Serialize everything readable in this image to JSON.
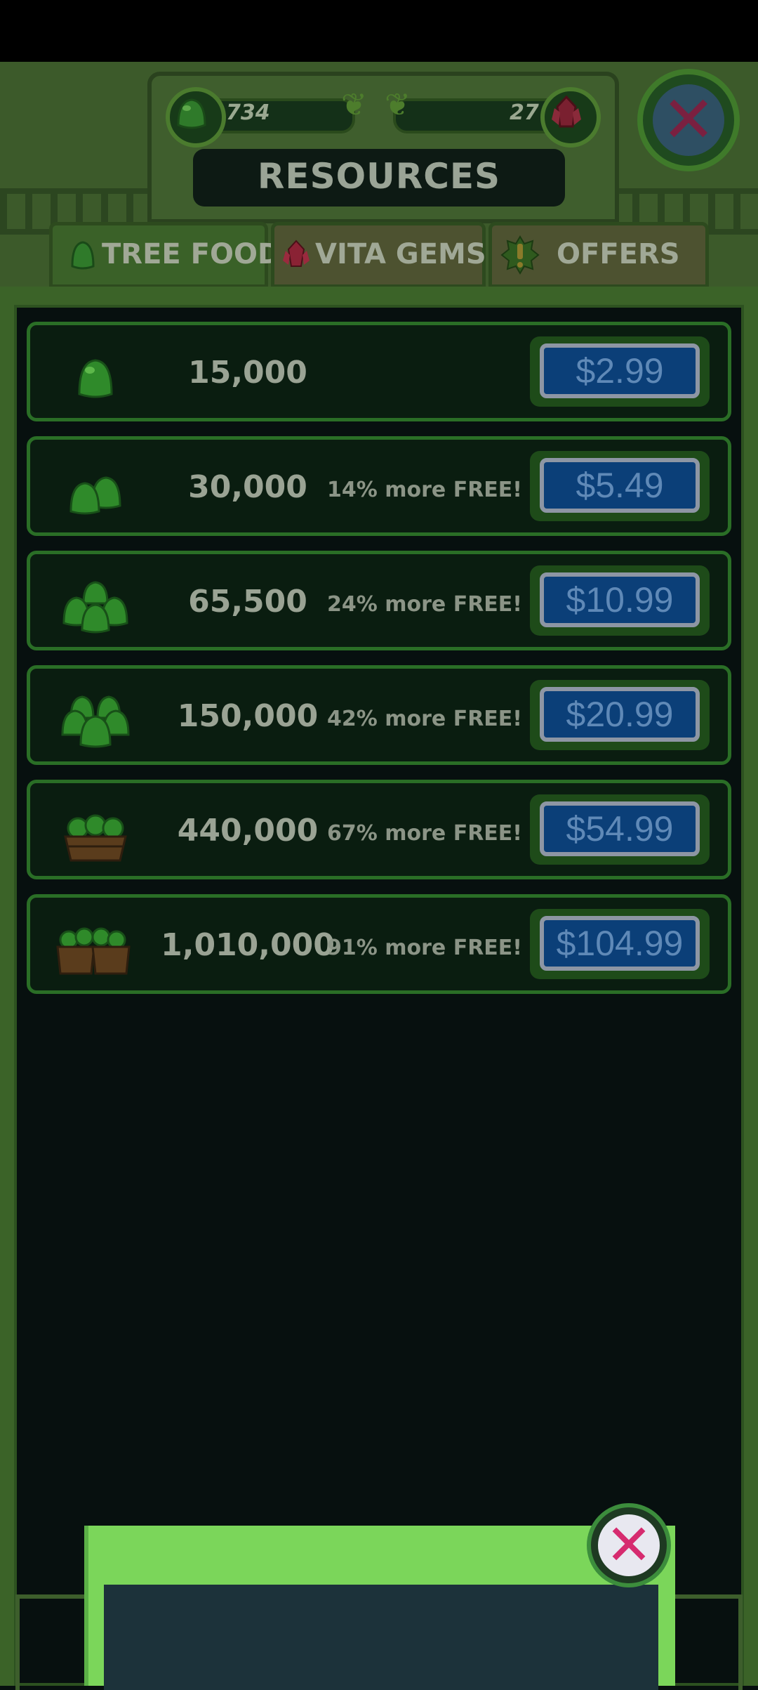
{
  "header": {
    "tree_food_count": "734",
    "vita_gems_count": "27",
    "title": "RESOURCES"
  },
  "tabs": [
    {
      "label": "TREE FOOD",
      "icon": "tree-food-icon",
      "active": true
    },
    {
      "label": "VITA GEMS",
      "icon": "gem-icon",
      "active": false
    },
    {
      "label": "OFFERS",
      "icon": "exclamation-badge-icon",
      "active": false
    }
  ],
  "offers": [
    {
      "quantity": "15,000",
      "bonus": "",
      "price": "$2.99",
      "icon": "single-gumdrop-icon"
    },
    {
      "quantity": "30,000",
      "bonus": "14% more FREE!",
      "price": "$5.49",
      "icon": "two-gumdrops-icon"
    },
    {
      "quantity": "65,500",
      "bonus": "24% more FREE!",
      "price": "$10.99",
      "icon": "gumdrop-pile-icon"
    },
    {
      "quantity": "150,000",
      "bonus": "42% more FREE!",
      "price": "$20.99",
      "icon": "gumdrop-heap-icon"
    },
    {
      "quantity": "440,000",
      "bonus": "67% more FREE!",
      "price": "$54.99",
      "icon": "gumdrop-basket-icon"
    },
    {
      "quantity": "1,010,000",
      "bonus": "91% more FREE!",
      "price": "$104.99",
      "icon": "gumdrop-crates-icon"
    }
  ],
  "colors": {
    "accent_green": "#2a6e26",
    "price_button": "#0b3f78",
    "popup_green": "#7bd65a",
    "close_pink": "#d62b6f"
  }
}
